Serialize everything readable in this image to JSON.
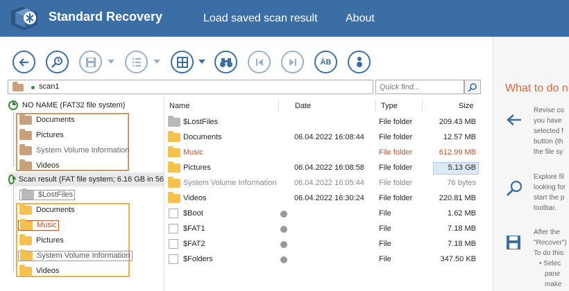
{
  "app": {
    "title": "Standard Recovery",
    "menu": [
      "Load saved scan result",
      "About"
    ],
    "colors": {
      "header": "#3b6ea5",
      "accent": "#d9673b",
      "tree_group_brown": "#c49a6c",
      "tree_group_yellow": "#e8b24a"
    }
  },
  "toolbar": {
    "buttons": [
      {
        "name": "back-icon"
      },
      {
        "name": "scan-search-icon"
      },
      {
        "name": "save-icon",
        "has_dropdown": true
      },
      {
        "name": "list-view-icon",
        "has_dropdown": true
      },
      {
        "name": "grid-view-icon",
        "has_dropdown": true
      },
      {
        "name": "binoculars-icon"
      },
      {
        "name": "previous-icon"
      },
      {
        "name": "next-icon"
      },
      {
        "name": "filename-format-icon",
        "glyph": "ÄB"
      },
      {
        "name": "info-icon"
      }
    ]
  },
  "pathbar": {
    "value": "scan1"
  },
  "quickfind": {
    "placeholder": "Quick find..."
  },
  "tree": {
    "root1": {
      "label": "NO NAME (FAT32 file system)"
    },
    "root1_items": [
      "Documents",
      "Pictures",
      "System Volume Information",
      "Videos"
    ],
    "root2": {
      "label": "Scan result (FAT file system; 6.16 GB in 56"
    },
    "root2_items": [
      "$LostFiles",
      "Documents",
      "Music",
      "Pictures",
      "System Volume Information",
      "Videos"
    ]
  },
  "list": {
    "columns": [
      "Name",
      "Date",
      "Type",
      "Size"
    ],
    "rows": [
      {
        "name": "$LostFiles",
        "date": "",
        "type": "File folder",
        "size": "209.43 MB",
        "icon": "folder-grey",
        "style": ""
      },
      {
        "name": "Documents",
        "date": "06.04.2022 16:08:44",
        "type": "File folder",
        "size": "12.57 MB",
        "icon": "folder-yellow",
        "style": ""
      },
      {
        "name": "Music",
        "date": "",
        "type": "File folder",
        "size": "612.99 MB",
        "icon": "folder-yellow",
        "style": "red"
      },
      {
        "name": "Pictures",
        "date": "06.04.2022 16:08:58",
        "type": "File folder",
        "size": "5.13 GB",
        "icon": "folder-yellow",
        "style": "selected"
      },
      {
        "name": "System Volume Information",
        "date": "06.04.2022 16:05:44",
        "type": "File folder",
        "size": "76 bytes",
        "icon": "folder-yellow",
        "style": "grey"
      },
      {
        "name": "Videos",
        "date": "06.04.2022 16:30:24",
        "type": "File folder",
        "size": "220.81 MB",
        "icon": "folder-yellow",
        "style": ""
      },
      {
        "name": "$Boot",
        "date": "",
        "type": "File",
        "size": "1.62 MB",
        "icon": "file",
        "style": ""
      },
      {
        "name": "$FAT1",
        "date": "",
        "type": "File",
        "size": "7.18 MB",
        "icon": "file",
        "style": ""
      },
      {
        "name": "$FAT2",
        "date": "",
        "type": "File",
        "size": "7.18 MB",
        "icon": "file",
        "style": ""
      },
      {
        "name": "$Folders",
        "date": "",
        "type": "File",
        "size": "347.50 KB",
        "icon": "file",
        "style": ""
      }
    ]
  },
  "help": {
    "title": "What to do n",
    "block1": [
      "Revise co",
      "you have",
      "selected f",
      "button (th",
      "the file sy"
    ],
    "block2": [
      "Explore fil",
      "looking for",
      "start the p",
      "toolbar."
    ],
    "block3": [
      "After the",
      "\"Recover\")",
      "To do this:",
      "• Selec",
      "pane",
      "make"
    ]
  }
}
